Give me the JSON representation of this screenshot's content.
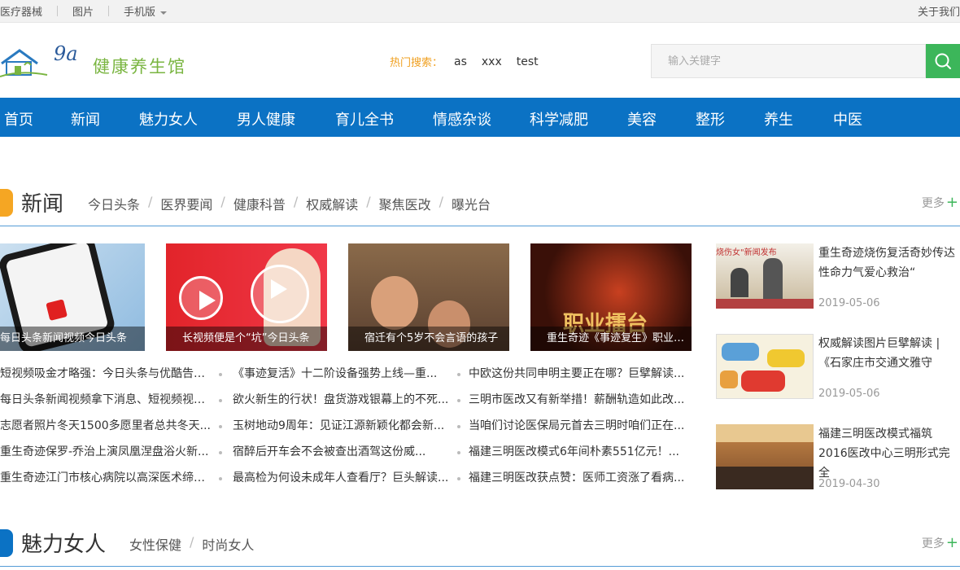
{
  "topbar": {
    "items": [
      "医疗器械",
      "图片",
      "手机版"
    ],
    "right_link": "关于我们"
  },
  "logo": {
    "num": "9a",
    "name": "健康养生馆"
  },
  "hot_search": {
    "label": "热门搜索：",
    "keywords": [
      "as",
      "xxx",
      "test"
    ]
  },
  "search": {
    "placeholder": "输入关键字",
    "value": ""
  },
  "nav": [
    "首页",
    "新闻",
    "魅力女人",
    "男人健康",
    "育儿全书",
    "情感杂谈",
    "科学减肥",
    "美容",
    "整形",
    "养生",
    "中医"
  ],
  "news_section": {
    "title": "新闻",
    "tabs": [
      "今日头条",
      "医界要闻",
      "健康科普",
      "权威解读",
      "聚焦医改",
      "曝光台"
    ],
    "more": "更多",
    "thumbs": [
      "每日头条新闻视频今日头条",
      "长视频便是个“坑”今日头条",
      "宿迁有个5岁不会言语的孩子",
      "重生奇迹《事迹复生》职业擂台"
    ],
    "lists": [
      [
        "短视频吸金才略强：今日头条与优酷告终...",
        "每日头条新闻视频拿下消息、短视频视频...",
        "志愿者照片冬天1500多愿里者总共冬天...",
        "重生奇迹保罗-乔治上演凤凰涅盘浴火新...",
        "重生奇迹江门市核心病院以高深医术缔造..."
      ],
      [
        "《事迹复活》十二阶设备强势上线—重...",
        "欲火新生的行状！盘货游戏银幕上的不死...",
        "玉树地动9周年：见证江源新颖化都会新...",
        "宿醉后开车会不会被查出酒驾这份威...",
        "最高检为何设未成年人查看厅？巨头解读..."
      ],
      [
        "中欧这份共同申明主要正在哪？巨擘解读...",
        "三明市医改又有新举措！薪酬轨造如此改...",
        "当咱们讨论医保局元首去三明时咱们正在...",
        "福建三明医改模式6年间朴素551亿元！...",
        "福建三明医改获点赞：医师工资涨了看病..."
      ]
    ],
    "side": [
      {
        "title": "重生奇迹烧伤复活奇妙传达性命力气爱心救治“",
        "date": "2019-05-06",
        "img_text": "烧伤女\"新闻发布"
      },
      {
        "title": "权威解读图片巨擘解读 | 《石家庄市交通文雅守",
        "date": "2019-05-06"
      },
      {
        "title": "福建三明医改模式福筑2016医改中心三明形式完全",
        "date": "2019-04-30"
      }
    ]
  },
  "women_section": {
    "title": "魅力女人",
    "tabs": [
      "女性保健",
      "时尚女人"
    ],
    "more": "更多"
  },
  "colors": {
    "nav": "#0b72c4",
    "accent_green": "#3cb65a",
    "hot_label": "#f0a020",
    "logo_green": "#7ab541"
  }
}
